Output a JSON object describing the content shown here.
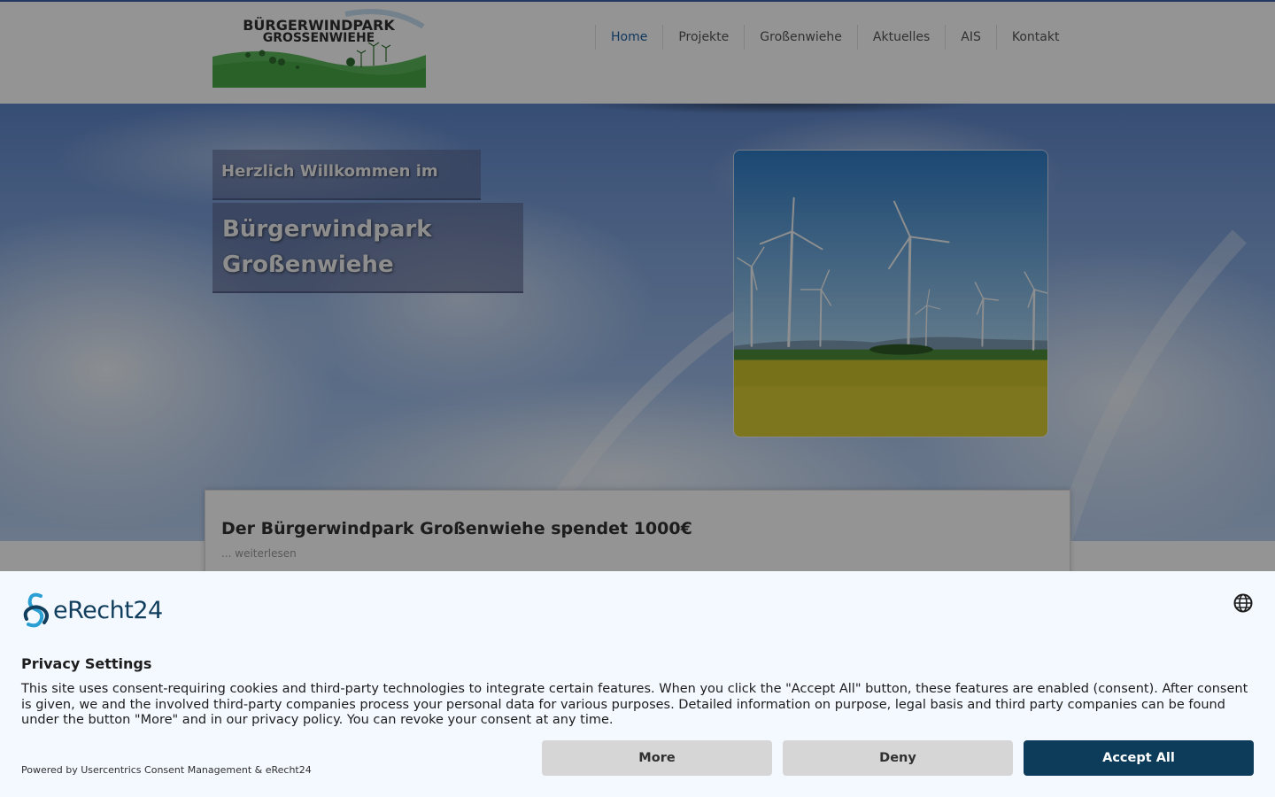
{
  "header": {
    "logo": {
      "line1": "BÜRGERWINDPARK",
      "line2": "GROSSENWIEHE"
    },
    "nav": [
      {
        "label": "Home",
        "active": true
      },
      {
        "label": "Projekte",
        "active": false
      },
      {
        "label": "Großenwiehe",
        "active": false
      },
      {
        "label": "Aktuelles",
        "active": false
      },
      {
        "label": "AIS",
        "active": false
      },
      {
        "label": "Kontakt",
        "active": false
      }
    ]
  },
  "hero": {
    "welcome_small": "Herzlich Willkommen im",
    "welcome_big_line1": "Bürgerwindpark",
    "welcome_big_line2": "Großenwiehe"
  },
  "news": {
    "title": "Der Bürgerwindpark Großenwiehe spendet 1000€",
    "more": "... weiterlesen"
  },
  "consent": {
    "brand": "eRecht24",
    "title": "Privacy Settings",
    "text": "This site uses consent-requiring cookies and third-party technologies to integrate certain features. When you click the \"Accept All\" button, these features are enabled (consent). After consent is given, we and the involved third-party companies process your personal data for various purposes. Detailed information on purpose, legal basis and third party companies can be found under the button \"More\" and in our privacy policy. You can revoke your consent at any time.",
    "powered_by": "Powered by Usercentrics Consent Management & eRecht24",
    "buttons": {
      "more": "More",
      "deny": "Deny",
      "accept": "Accept All"
    }
  },
  "colors": {
    "nav_active": "#1f5fa3",
    "accept_button": "#0d3b5a",
    "secondary_button": "#d6d6d6",
    "banner_background": "#f4f8ff"
  },
  "icons": {
    "language": "globe-icon"
  }
}
